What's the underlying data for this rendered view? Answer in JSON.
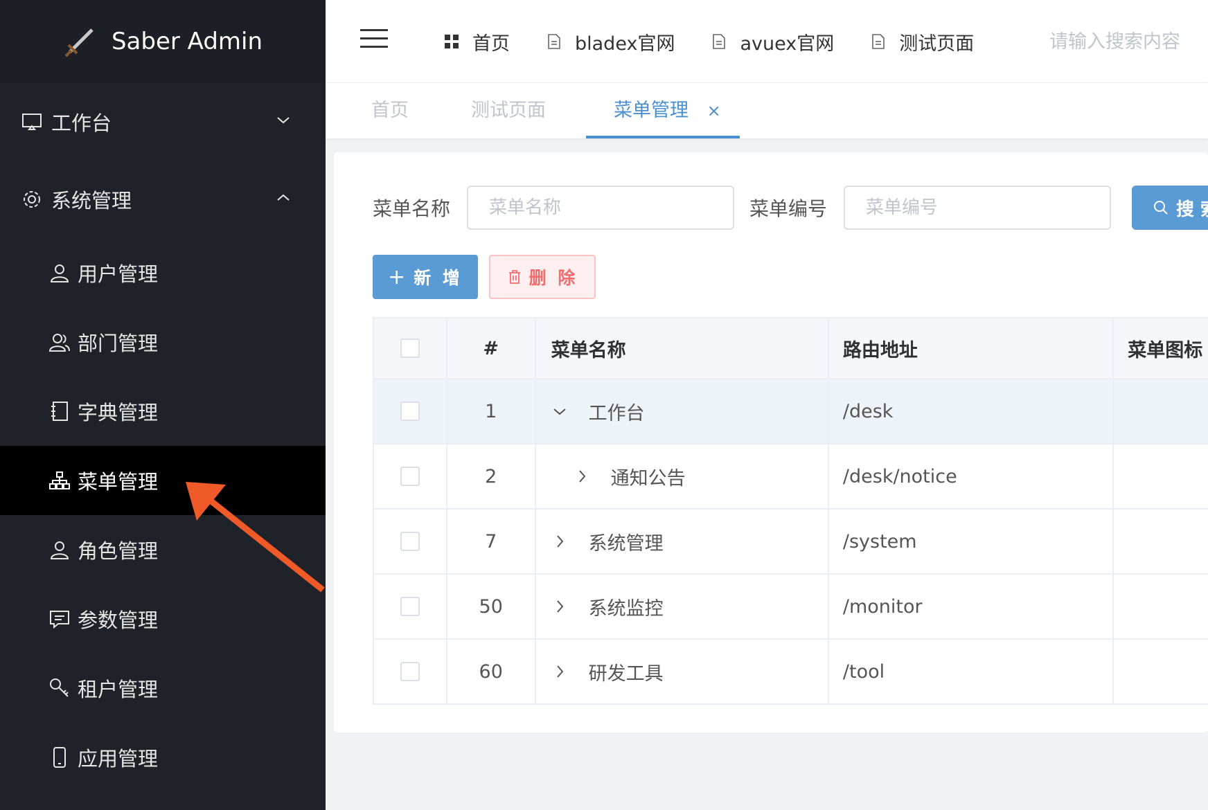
{
  "app": {
    "title": "Saber Admin"
  },
  "sidebar": {
    "groups": [
      {
        "label": "工作台",
        "icon": "monitor-icon",
        "expanded": false
      },
      {
        "label": "系统管理",
        "icon": "gear-icon",
        "expanded": true
      }
    ],
    "items": [
      {
        "label": "用户管理",
        "icon": "user-icon"
      },
      {
        "label": "部门管理",
        "icon": "users-icon"
      },
      {
        "label": "字典管理",
        "icon": "notebook-icon"
      },
      {
        "label": "菜单管理",
        "icon": "hierarchy-icon",
        "active": true
      },
      {
        "label": "角色管理",
        "icon": "user-icon"
      },
      {
        "label": "参数管理",
        "icon": "chat-icon"
      },
      {
        "label": "租户管理",
        "icon": "key-icon"
      },
      {
        "label": "应用管理",
        "icon": "phone-icon"
      }
    ]
  },
  "topnav": {
    "items": [
      {
        "label": "首页",
        "icon": "grid-icon"
      },
      {
        "label": "bladex官网",
        "icon": "document-icon"
      },
      {
        "label": "avuex官网",
        "icon": "document-icon"
      },
      {
        "label": "测试页面",
        "icon": "document-icon"
      }
    ],
    "search_placeholder": "请输入搜索内容"
  },
  "tabs": [
    {
      "label": "首页",
      "active": false
    },
    {
      "label": "测试页面",
      "active": false
    },
    {
      "label": "菜单管理",
      "active": true,
      "close": "×"
    }
  ],
  "search": {
    "name_label": "菜单名称",
    "name_placeholder": "菜单名称",
    "code_label": "菜单编号",
    "code_placeholder": "菜单编号",
    "button": "搜 索"
  },
  "actions": {
    "add": "新 增",
    "delete": "删 除"
  },
  "table": {
    "headers": {
      "index": "#",
      "name": "菜单名称",
      "path": "路由地址",
      "icon": "菜单图标"
    },
    "rows": [
      {
        "index": "1",
        "name": "工作台",
        "path": "/desk",
        "expand": "expanded",
        "level": 0
      },
      {
        "index": "2",
        "name": "通知公告",
        "path": "/desk/notice",
        "expand": "collapsed",
        "level": 1
      },
      {
        "index": "7",
        "name": "系统管理",
        "path": "/system",
        "expand": "collapsed",
        "level": 0
      },
      {
        "index": "50",
        "name": "系统监控",
        "path": "/monitor",
        "expand": "collapsed",
        "level": 0
      },
      {
        "index": "60",
        "name": "研发工具",
        "path": "/tool",
        "expand": "collapsed",
        "level": 0
      }
    ]
  },
  "colors": {
    "sidebar_bg": "#20222a",
    "primary": "#5b9bd5",
    "danger": "#f56c6c",
    "annotation_arrow": "#f05a28"
  }
}
